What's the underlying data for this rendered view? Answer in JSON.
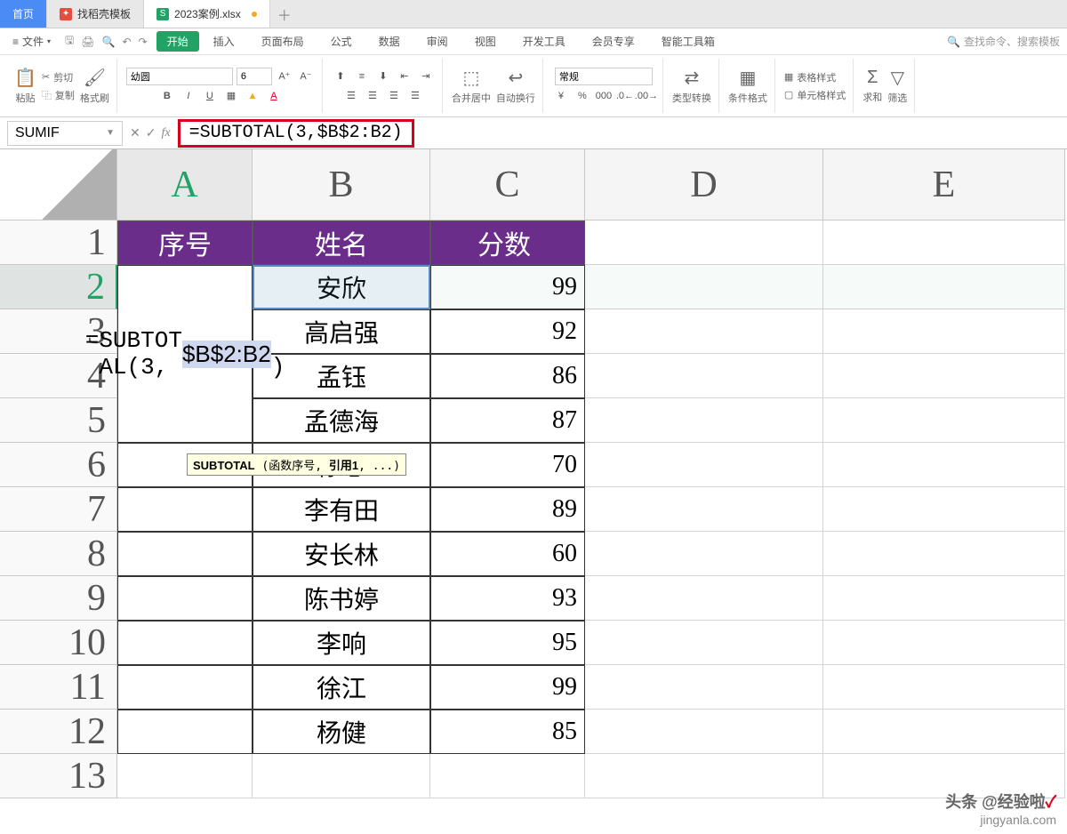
{
  "tabs": {
    "home": "首页",
    "tpl": "找稻壳模板",
    "file": "2023案例.xlsx"
  },
  "menubar": {
    "file": "文件",
    "items": [
      "开始",
      "插入",
      "页面布局",
      "公式",
      "数据",
      "审阅",
      "视图",
      "开发工具",
      "会员专享",
      "智能工具箱"
    ],
    "search_placeholder": "查找命令、搜索模板"
  },
  "ribbon": {
    "paste": "粘贴",
    "cut": "剪切",
    "copy": "复制",
    "format_painter": "格式刷",
    "font_name": "幼圆",
    "font_size": "6",
    "merge": "合并居中",
    "wrap": "自动换行",
    "number_format": "常规",
    "type_convert": "类型转换",
    "cond_format": "条件格式",
    "table_style": "表格样式",
    "cell_style": "单元格样式",
    "sum": "求和",
    "filter": "筛选"
  },
  "formula_bar": {
    "name_box": "SUMIF",
    "formula": "=SUBTOTAL(3,$B$2:B2)"
  },
  "columns": [
    "A",
    "B",
    "C",
    "D",
    "E"
  ],
  "row_numbers": [
    "1",
    "2",
    "3",
    "4",
    "5",
    "6",
    "7",
    "8",
    "9",
    "10",
    "11",
    "12",
    "13"
  ],
  "headers": {
    "a": "序号",
    "b": "姓名",
    "c": "分数"
  },
  "edit_cell_text": "=SUBTOTAL(3,$B$2:B2)",
  "edit_cell_hl": "$B$2:B2",
  "data_rows": [
    {
      "b": "安欣",
      "c": "99"
    },
    {
      "b": "高启强",
      "c": "92"
    },
    {
      "b": "孟钰",
      "c": "86"
    },
    {
      "b": "孟德海",
      "c": "87"
    },
    {
      "b": "徐忠",
      "c": "70"
    },
    {
      "b": "李有田",
      "c": "89"
    },
    {
      "b": "安长林",
      "c": "60"
    },
    {
      "b": "陈书婷",
      "c": "93"
    },
    {
      "b": "李响",
      "c": "95"
    },
    {
      "b": "徐江",
      "c": "99"
    },
    {
      "b": "杨健",
      "c": "85"
    }
  ],
  "tooltip": "SUBTOTAL (函数序号, 引用1, ...)",
  "watermark": {
    "line1": "头条 @经验啦",
    "line2": "jingyanla.com",
    "check": "✓"
  }
}
